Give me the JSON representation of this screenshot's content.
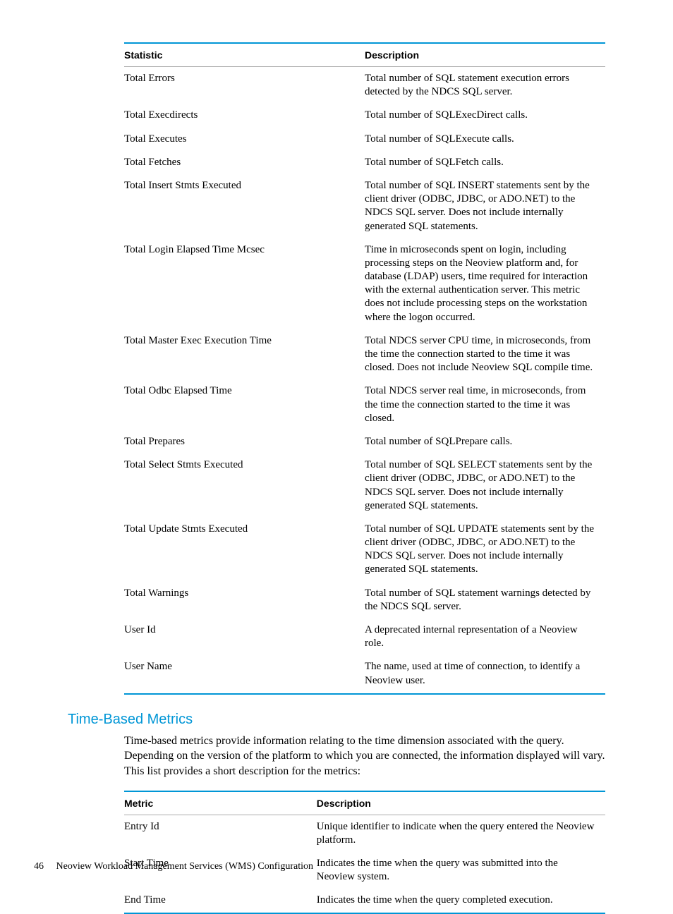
{
  "table1": {
    "headers": {
      "c1": "Statistic",
      "c2": "Description"
    },
    "rows": [
      {
        "c1": "Total Errors",
        "c2": "Total number of SQL statement execution errors detected by the NDCS SQL server."
      },
      {
        "c1": "Total Execdirects",
        "c2": "Total number of SQLExecDirect calls."
      },
      {
        "c1": "Total Executes",
        "c2": "Total number of SQLExecute calls."
      },
      {
        "c1": "Total Fetches",
        "c2": "Total number of SQLFetch calls."
      },
      {
        "c1": "Total Insert Stmts Executed",
        "c2": "Total number of SQL INSERT statements sent by the client driver (ODBC, JDBC, or ADO.NET) to the NDCS SQL server. Does not include internally generated SQL statements."
      },
      {
        "c1": "Total Login Elapsed Time Mcsec",
        "c2": "Time in microseconds spent on login, including processing steps on the Neoview platform and, for database (LDAP) users, time required for interaction with the external authentication server. This metric does not include processing steps on the workstation where the logon occurred."
      },
      {
        "c1": "Total Master Exec Execution Time",
        "c2": "Total NDCS server CPU time, in microseconds, from the time the connection started to the time it was closed. Does not include Neoview SQL compile time."
      },
      {
        "c1": "Total Odbc Elapsed Time",
        "c2": "Total NDCS server real time, in microseconds, from the time the connection started to the time it was closed."
      },
      {
        "c1": "Total Prepares",
        "c2": "Total number of SQLPrepare calls."
      },
      {
        "c1": "Total Select Stmts Executed",
        "c2": "Total number of SQL SELECT statements sent by the client driver (ODBC, JDBC, or ADO.NET) to the NDCS SQL server. Does not include internally generated SQL statements."
      },
      {
        "c1": "Total Update Stmts Executed",
        "c2": "Total number of SQL UPDATE statements sent by the client driver (ODBC, JDBC, or ADO.NET) to the NDCS SQL server. Does not include internally generated SQL statements."
      },
      {
        "c1": "Total Warnings",
        "c2": "Total number of SQL statement warnings detected by the NDCS SQL server."
      },
      {
        "c1": "User Id",
        "c2": "A deprecated internal representation of a Neoview role."
      },
      {
        "c1": "User Name",
        "c2": "The name, used at time of connection, to identify a Neoview user."
      }
    ]
  },
  "section": {
    "heading": "Time-Based Metrics",
    "paragraph": "Time-based metrics provide information relating to the time dimension associated with the query. Depending on the version of the platform to which you are connected, the information displayed will vary. This list provides a short description for the metrics:"
  },
  "table2": {
    "headers": {
      "c1": "Metric",
      "c2": "Description"
    },
    "rows": [
      {
        "c1": "Entry Id",
        "c2": "Unique identifier to indicate when the query entered the Neoview platform."
      },
      {
        "c1": "Start Time",
        "c2": "Indicates the time when the query was submitted into the Neoview system."
      },
      {
        "c1": "End Time",
        "c2": "Indicates the time when the query completed execution."
      }
    ]
  },
  "footer": {
    "page": "46",
    "title": "Neoview Workload Management Services (WMS) Configuration"
  }
}
